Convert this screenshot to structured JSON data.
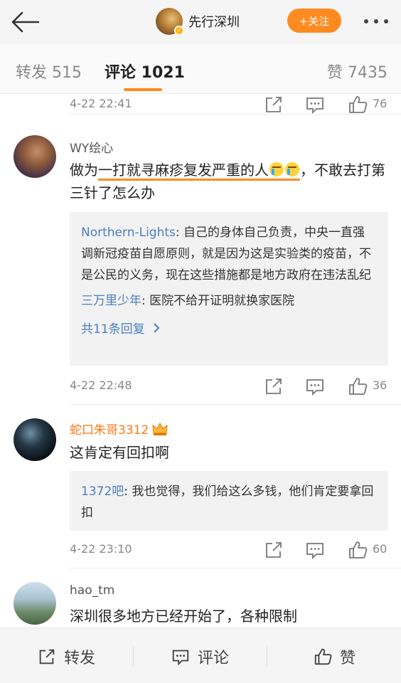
{
  "header": {
    "back_icon": "arrow-left-icon",
    "account_name": "先行深圳",
    "follow_label": "+关注",
    "more_icon": "more-horizontal-icon",
    "accent_color": "#ff8a1f"
  },
  "tabs": [
    {
      "label": "转发 515",
      "active": false
    },
    {
      "label": "评论 1021",
      "active": true
    },
    {
      "label": "赞 7435",
      "active": false
    }
  ],
  "comments": [
    {
      "time": "4-22 22:41",
      "likes": "76"
    },
    {
      "user": "WY绘心",
      "text_pre": "做为",
      "text_highlight": "一打就寻麻疹复发严重的人",
      "emoji": "crying-emoji",
      "text_post": "，不敢去打第三针了怎么办",
      "replies": [
        {
          "name": "Northern-Lights",
          "text": ": 自己的身体自己负责，中央一直强调新冠疫苗自愿原则，就是因为这是实验类的疫苗，不是公民的义务，现在这些措施都是地方政府在违法乱纪"
        },
        {
          "name": "三万里少年",
          "text": ": 医院不给开证明就换家医院"
        }
      ],
      "more_replies": "共11条回复",
      "time": "4-22 22:48",
      "likes": "36"
    },
    {
      "user": "蛇口朱哥3312",
      "badge": "crown-badge-icon",
      "text": "这肯定有回扣啊",
      "replies": [
        {
          "name": "1372吧",
          "text": ": 我也觉得，我们给这么多钱，他们肯定要拿回扣"
        }
      ],
      "time": "4-22 23:10",
      "likes": "60"
    },
    {
      "user": "hao_tm",
      "text": "深圳很多地方已经开始了，各种限制"
    }
  ],
  "bottom": {
    "repost_label": "转发",
    "comment_label": "评论",
    "like_label": "赞"
  }
}
